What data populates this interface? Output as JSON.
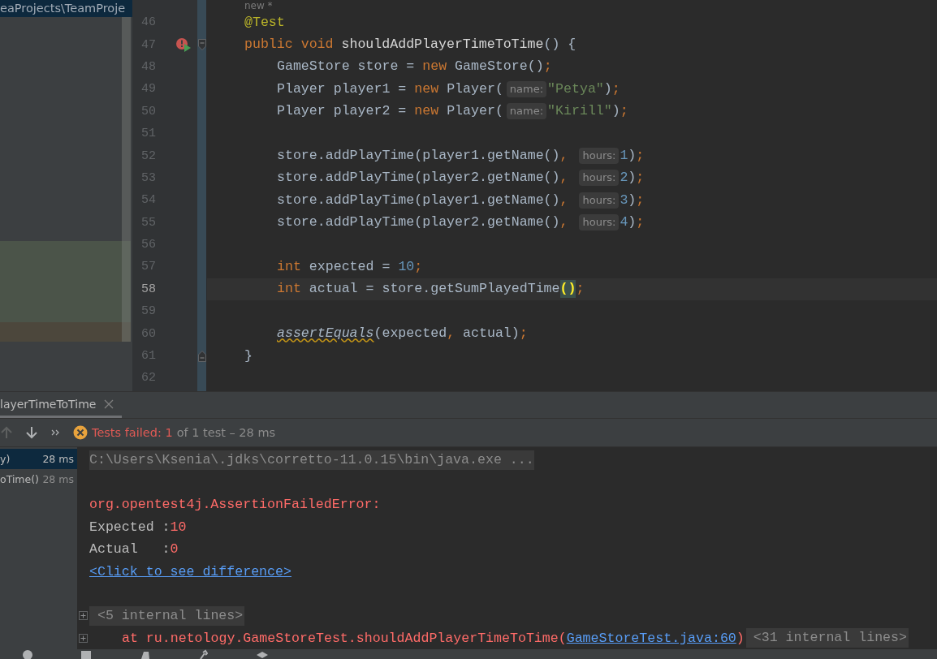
{
  "project_panel": {
    "path": "eaProjects\\TeamProje"
  },
  "editor": {
    "usage_hint": "new *",
    "lines": [
      {
        "number": "46",
        "current": false,
        "tokens": [
          {
            "kind": "annotation",
            "text": "@Test"
          }
        ]
      },
      {
        "number": "47",
        "current": false,
        "failed_test": true,
        "fold_start": true,
        "tokens": [
          {
            "kind": "keyword",
            "text": "public void "
          },
          {
            "kind": "method",
            "text": "shouldAddPlayerTimeToTime"
          },
          {
            "kind": "plain",
            "text": "() {"
          }
        ],
        "children": [
          {
            "number": "48",
            "current": false,
            "tokens": [
              {
                "kind": "plain",
                "text": "GameStore store = "
              },
              {
                "kind": "keyword",
                "text": "new"
              },
              {
                "kind": "plain",
                "text": " GameStore()"
              },
              {
                "kind": "punct",
                "text": ";"
              }
            ]
          },
          {
            "number": "49",
            "current": false,
            "tokens": [
              {
                "kind": "plain",
                "text": "Player player1 = "
              },
              {
                "kind": "keyword",
                "text": "new"
              },
              {
                "kind": "plain",
                "text": " Player("
              },
              {
                "kind": "hint",
                "text": "name:"
              },
              {
                "kind": "string",
                "text": "\"Petya\""
              },
              {
                "kind": "plain",
                "text": ")"
              },
              {
                "kind": "punct",
                "text": ";"
              }
            ]
          },
          {
            "number": "50",
            "current": false,
            "tokens": [
              {
                "kind": "plain",
                "text": "Player player2 = "
              },
              {
                "kind": "keyword",
                "text": "new"
              },
              {
                "kind": "plain",
                "text": " Player("
              },
              {
                "kind": "hint",
                "text": "name:"
              },
              {
                "kind": "string",
                "text": "\"Kirill\""
              },
              {
                "kind": "plain",
                "text": ")"
              },
              {
                "kind": "punct",
                "text": ";"
              }
            ]
          },
          {
            "number": "51",
            "current": false
          },
          {
            "number": "52",
            "current": false,
            "tokens": [
              {
                "kind": "plain",
                "text": "store.addPlayTime(player1.getName()"
              },
              {
                "kind": "punct",
                "text": ", "
              },
              {
                "kind": "hint",
                "text": "hours:"
              },
              {
                "kind": "number",
                "text": "1"
              },
              {
                "kind": "plain",
                "text": ")"
              },
              {
                "kind": "punct",
                "text": ";"
              }
            ]
          },
          {
            "number": "53",
            "current": false,
            "tokens": [
              {
                "kind": "plain",
                "text": "store.addPlayTime(player2.getName()"
              },
              {
                "kind": "punct",
                "text": ", "
              },
              {
                "kind": "hint",
                "text": "hours:"
              },
              {
                "kind": "number",
                "text": "2"
              },
              {
                "kind": "plain",
                "text": ")"
              },
              {
                "kind": "punct",
                "text": ";"
              }
            ]
          },
          {
            "number": "54",
            "current": false,
            "tokens": [
              {
                "kind": "plain",
                "text": "store.addPlayTime(player1.getName()"
              },
              {
                "kind": "punct",
                "text": ", "
              },
              {
                "kind": "hint",
                "text": "hours:"
              },
              {
                "kind": "number",
                "text": "3"
              },
              {
                "kind": "plain",
                "text": ")"
              },
              {
                "kind": "punct",
                "text": ";"
              }
            ]
          },
          {
            "number": "55",
            "current": false,
            "tokens": [
              {
                "kind": "plain",
                "text": "store.addPlayTime(player2.getName()"
              },
              {
                "kind": "punct",
                "text": ", "
              },
              {
                "kind": "hint",
                "text": "hours:"
              },
              {
                "kind": "number",
                "text": "4"
              },
              {
                "kind": "plain",
                "text": ")"
              },
              {
                "kind": "punct",
                "text": ";"
              }
            ]
          },
          {
            "number": "56",
            "current": false
          },
          {
            "number": "57",
            "current": false,
            "tokens": [
              {
                "kind": "keyword",
                "text": "int"
              },
              {
                "kind": "plain",
                "text": " expected = "
              },
              {
                "kind": "number",
                "text": "10"
              },
              {
                "kind": "punct",
                "text": ";"
              }
            ]
          },
          {
            "number": "58",
            "current": true,
            "tokens": [
              {
                "kind": "keyword",
                "text": "int"
              },
              {
                "kind": "plain",
                "text": " actual = store.getSumPlayedTime"
              },
              {
                "kind": "match",
                "text": "()"
              },
              {
                "kind": "punct",
                "text": ";"
              }
            ]
          },
          {
            "number": "59",
            "current": false
          },
          {
            "number": "60",
            "current": false,
            "tokens": [
              {
                "kind": "static",
                "text": "assertEquals"
              },
              {
                "kind": "plain",
                "text": "(expected"
              },
              {
                "kind": "punct",
                "text": ", "
              },
              {
                "kind": "plain",
                "text": "actual)"
              },
              {
                "kind": "punct",
                "text": ";"
              }
            ]
          }
        ]
      },
      {
        "number": "61",
        "current": false,
        "fold_end": true,
        "tokens": [
          {
            "kind": "plain",
            "text": "}"
          }
        ]
      },
      {
        "number": "62",
        "current": false
      }
    ]
  },
  "run_panel": {
    "tab": {
      "label": "layerTimeToTime",
      "selected": true
    },
    "status": {
      "failed": "Tests failed: 1",
      "rest": "of 1 test – 28 ms"
    },
    "tree": [
      {
        "name": "y)",
        "time": "28 ms",
        "selected": true
      },
      {
        "name": "oTime()",
        "time": "28 ms",
        "selected": false
      }
    ],
    "console": [
      {
        "kind": "command",
        "text": "C:\\Users\\Ksenia\\.jdks\\corretto-11.0.15\\bin\\java.exe ..."
      },
      {
        "kind": "blank"
      },
      {
        "kind": "error",
        "text": "org.opentest4j.AssertionFailedError:"
      },
      {
        "kind": "value",
        "label": "Expected :",
        "value": "10"
      },
      {
        "kind": "value",
        "label": "Actual   :",
        "value": "0"
      },
      {
        "kind": "link",
        "text": "<Click to see difference>"
      },
      {
        "kind": "blank"
      },
      {
        "kind": "folded",
        "text": "<5 internal lines>"
      },
      {
        "kind": "stack",
        "before": "at ru.netology.GameStoreTest.shouldAddPlayerTimeToTime(",
        "link": "GameStoreTest.java:60",
        "after": ")",
        "folded": "<31 internal lines>"
      }
    ]
  }
}
